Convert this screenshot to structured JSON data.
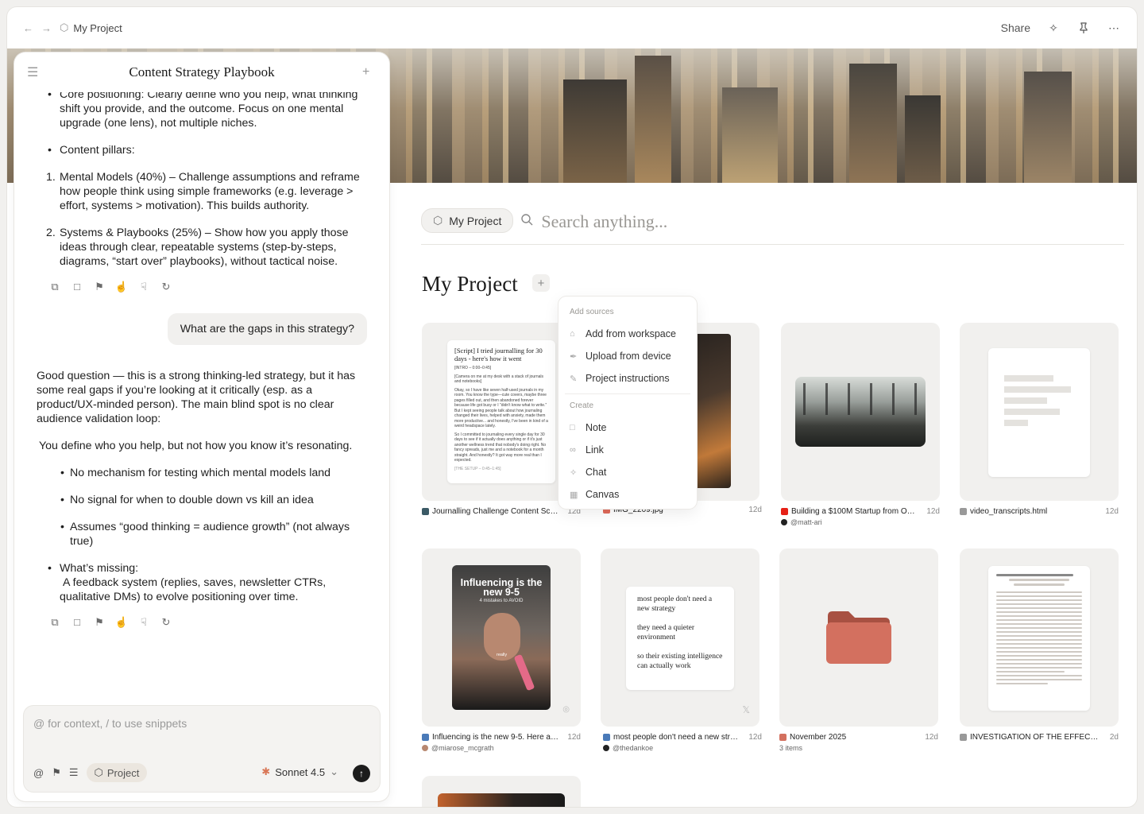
{
  "topbar": {
    "project_name": "My Project",
    "share_label": "Share"
  },
  "chat": {
    "title": "Content Strategy Playbook",
    "messages_1": {
      "bullet_core": "Core positioning: Clearly define who you help, what thinking shift you provide, and the outcome. Focus on one mental upgrade (one lens), not multiple niches.",
      "bullet_pillars": "Content pillars:",
      "item_1": "Mental Models (40%) – Challenge assumptions and reframe how people think using simple frameworks (e.g. leverage > effort, systems > motivation). This builds authority.",
      "item_2": "Systems & Playbooks (25%) – Show how you apply those ideas through clear, repeatable systems (step-by-steps, diagrams, “start over” playbooks), without tactical noise."
    },
    "user_message": "What are the gaps in this strategy?",
    "messages_2": {
      "intro": "Good question — this is a strong thinking-led strategy, but it has some real gaps if you’re looking at it critically (esp. as a product/UX-minded person). The main blind spot is no clear audience validation loop:",
      "para": "You define who you help, but not how you know it’s resonating.",
      "sub_1": "No mechanism for testing which mental models land",
      "sub_2": "No signal for when to double down vs kill an idea",
      "sub_3": "Assumes “good thinking = audience growth” (not always true)",
      "missing": "What’s missing:",
      "missing_detail": "A feedback system (replies, saves, newsletter CTRs, qualitative DMs) to evolve positioning over time."
    },
    "composer": {
      "placeholder": "@ for context, / to use snippets",
      "project_chip": "Project",
      "model": "Sonnet 4.5"
    }
  },
  "main": {
    "search_chip": "My Project",
    "search_placeholder": "Search anything...",
    "title": "My Project",
    "menu": {
      "section_sources": "Add sources",
      "add_workspace": "Add from workspace",
      "upload_device": "Upload from device",
      "project_instructions": "Project instructions",
      "section_create": "Create",
      "note": "Note",
      "link": "Link",
      "chat": "Chat",
      "canvas": "Canvas"
    },
    "cards": [
      {
        "name": "Journalling Challenge Content Script",
        "time": "12d"
      },
      {
        "name": "IMG_2209.jpg",
        "time": "12d"
      },
      {
        "name": "Building a $100M Startup from Our…",
        "time": "12d",
        "author": "@matt-ari"
      },
      {
        "name": "video_transcripts.html",
        "time": "12d"
      },
      {
        "name": "Influencing is the new 9-5. Here are…",
        "time": "12d",
        "author": "@miarose_mcgrath"
      },
      {
        "name": "most people don't need a new strate…",
        "time": "12d",
        "author": "@thedankoe"
      },
      {
        "name": "November 2025",
        "time": "12d",
        "author": "3 items"
      },
      {
        "name": "INVESTIGATION OF THE EFFECT OF T…",
        "time": "2d"
      }
    ],
    "script_doc": {
      "title": "[Script] I tried journalling for 30 days - here's how it went",
      "intro": "[INTRO – 0:00–0:45]",
      "l1": "[Camera on me at my desk with a stack of journals and notebooks]",
      "l2": "Okay, so I have like seven half-used journals in my room. You know the type—cute covers, maybe three pages filled out, and then abandoned forever because life got busy or I \"didn't know what to write.\" But I kept seeing people talk about how journaling changed their lives, helped with anxiety, made them more productive... and honestly, I've been in kind of a weird headspace lately.",
      "l3": "So I committed to journaling every single day for 30 days to see if it actually does anything or if it's just another wellness trend that nobody's doing right. No fancy spreads, just me and a notebook for a month straight. And honestly? It got way more real than I expected.",
      "l4": "[THE SETUP – 0:45–1:45]"
    },
    "tweet_doc": {
      "p1": "most people don't need a new strategy",
      "p2": "they need a quieter environment",
      "p3": "so their existing intelligence can actually work"
    },
    "reel": {
      "headline": "Influencing is the new 9-5",
      "sub": "4 mistakes to AVOID",
      "caption": "really"
    }
  },
  "colors": {
    "accent_folder": "#d3705f",
    "send_button": "#1c1c1c",
    "chip_bg": "#ebe6df"
  }
}
